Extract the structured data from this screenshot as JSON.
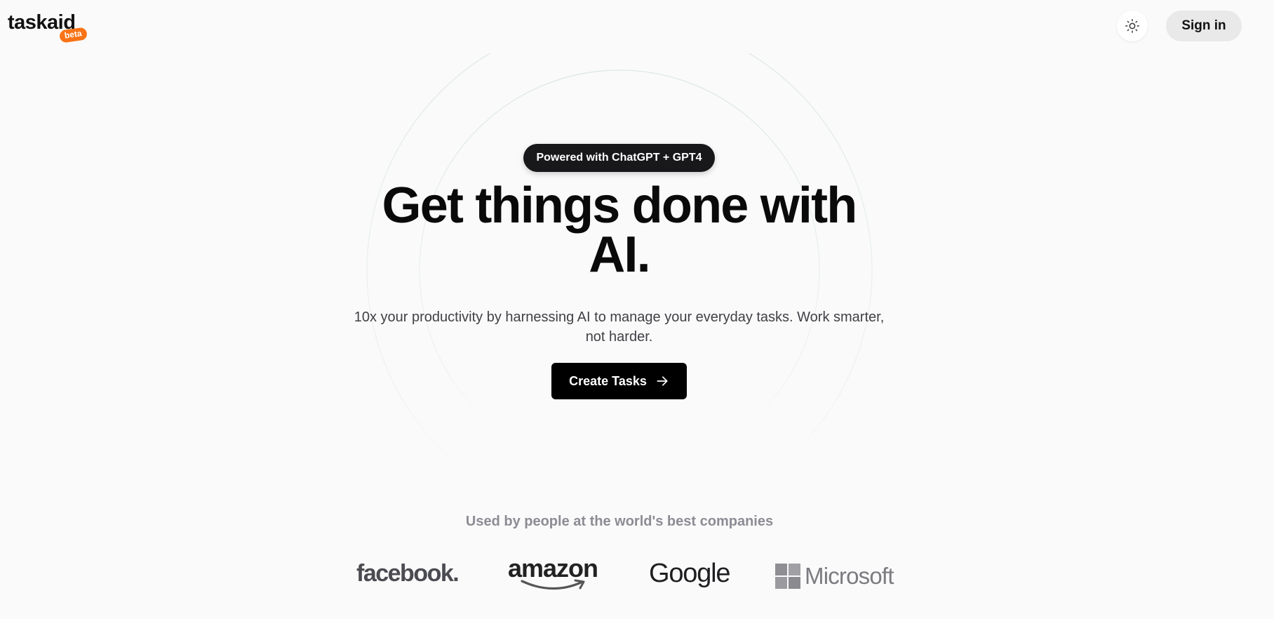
{
  "header": {
    "logo_text": "taskaid",
    "logo_badge": "beta",
    "theme_icon": "sun-icon",
    "signin_label": "Sign in"
  },
  "hero": {
    "pill_label": "Powered with ChatGPT + GPT4",
    "headline_line1": "Get things done with",
    "headline_line2": "AI.",
    "subtext": "10x your productivity by harnessing AI to manage your everyday tasks. Work smarter, not harder.",
    "cta_label": "Create Tasks",
    "cta_icon": "arrow-right-icon"
  },
  "companies": {
    "heading": "Used by people at the world's best companies",
    "logos": [
      "facebook.",
      "amazon",
      "Google",
      "Microsoft"
    ]
  },
  "colors": {
    "background": "#fafafa",
    "badge": "#f97316",
    "primary": "#000000",
    "pill": "#18181b",
    "muted_text": "#8c8c94"
  }
}
